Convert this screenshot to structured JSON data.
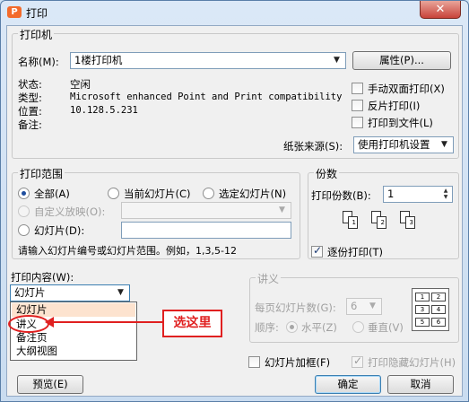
{
  "window": {
    "title": "打印",
    "app_icon_glyph": "P",
    "close_glyph": "✕",
    "colors": {
      "close_button": "#c8433a",
      "title_gradient": "#dbe8f7"
    }
  },
  "printer": {
    "group_label": "打印机",
    "name_label": "名称(M):",
    "name_value": "1楼打印机",
    "properties_button": "属性(P)...",
    "status_label": "状态:",
    "status_value": "空闲",
    "type_label": "类型:",
    "type_value": "Microsoft enhanced Point and Print compatibility dri",
    "location_label": "位置:",
    "location_value": "10.128.5.231",
    "comment_label": "备注:",
    "manual_duplex": "手动双面打印(X)",
    "reverse_print": "反片打印(I)",
    "print_to_file": "打印到文件(L)",
    "paper_source_label": "纸张来源(S):",
    "paper_source_value": "使用打印机设置"
  },
  "range": {
    "group_label": "打印范围",
    "all": "全部(A)",
    "current_slide": "当前幻灯片(C)",
    "selected_slides": "选定幻灯片(N)",
    "custom_show": "自定义放映(O):",
    "slides": "幻灯片(D):",
    "hint": "请输入幻灯片编号或幻灯片范围。例如，1,3,5-12"
  },
  "copies": {
    "group_label": "份数",
    "count_label": "打印份数(B):",
    "count_value": "1",
    "collate_label": "逐份打印(T)",
    "collate_pages": [
      "1",
      "2",
      "3"
    ]
  },
  "content": {
    "label": "打印内容(W):",
    "selected_value": "幻灯片",
    "options": [
      "幻灯片",
      "讲义",
      "备注页",
      "大纲视图"
    ],
    "annotation": "选这里"
  },
  "handouts": {
    "group_label": "讲义",
    "per_page_label": "每页幻灯片数(G):",
    "per_page_value": "6",
    "order_label": "顺序:",
    "horizontal": "水平(Z)",
    "vertical": "垂直(V)",
    "preview_cells": [
      "1",
      "2",
      "3",
      "4",
      "5",
      "6"
    ]
  },
  "options": {
    "frame_slides": "幻灯片加框(F)",
    "print_hidden": "打印隐藏幻灯片(H)"
  },
  "buttons": {
    "preview": "预览(E)",
    "ok": "确定",
    "cancel": "取消"
  }
}
